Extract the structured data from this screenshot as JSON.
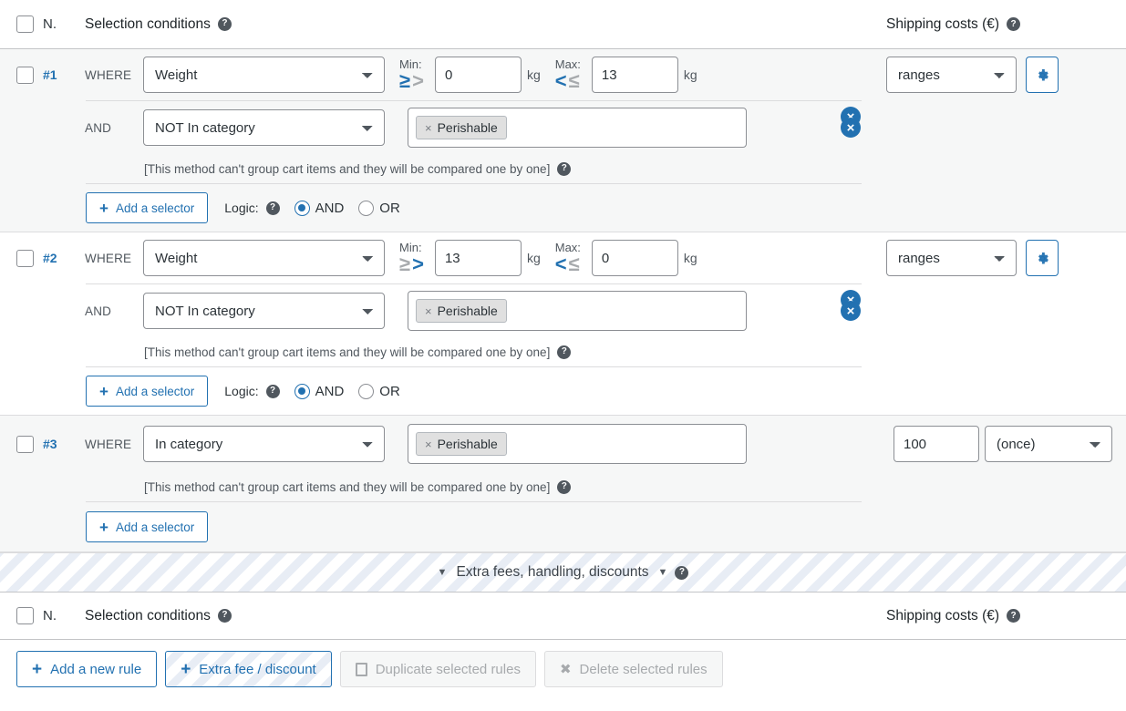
{
  "header": {
    "n_label": "N.",
    "conditions_label": "Selection conditions",
    "shipping_label": "Shipping costs (€)"
  },
  "labels": {
    "where": "WHERE",
    "and": "AND",
    "min": "Min:",
    "max": "Max:",
    "unit_kg": "kg",
    "add_selector": "Add a selector",
    "logic": "Logic:",
    "logic_and": "AND",
    "logic_or": "OR",
    "note": "[This method can't group cart items and they will be compared one by one]",
    "help_icon": "help-icon",
    "delete_icon": "delete-circle-icon",
    "gear_icon": "gear-icon",
    "tag_remove": "×",
    "op_gte": "≥",
    "op_gt": ">",
    "op_lt": "<",
    "op_lte": "≤"
  },
  "rules": [
    {
      "number": "#1",
      "condition": "Weight",
      "min_op_active": "gte",
      "min_value": "0",
      "max_op_active": "lt",
      "max_value": "13",
      "cost_mode": "ranges",
      "sub_condition": "NOT In category",
      "sub_tag": "Perishable",
      "logic_selected": "AND"
    },
    {
      "number": "#2",
      "condition": "Weight",
      "min_op_active": "gt",
      "min_value": "13",
      "max_op_active": "lt",
      "max_value": "0",
      "cost_mode": "ranges",
      "sub_condition": "NOT In category",
      "sub_tag": "Perishable",
      "logic_selected": "AND"
    },
    {
      "number": "#3",
      "condition": "In category",
      "tag": "Perishable",
      "cost_value": "100",
      "cost_mode": "(once)"
    }
  ],
  "extras_bar": {
    "caret_left": "▼",
    "label": "Extra fees, handling, discounts",
    "caret_right": "▼"
  },
  "toolbar": {
    "add_rule": "Add a new rule",
    "extra_fee": "Extra fee / discount",
    "duplicate": "Duplicate selected rules",
    "delete": "Delete selected rules",
    "plus": "+",
    "x": "✖"
  },
  "colors": {
    "accent": "#2271b1",
    "muted": "#a7aaad",
    "row_shaded": "#f6f7f7"
  }
}
